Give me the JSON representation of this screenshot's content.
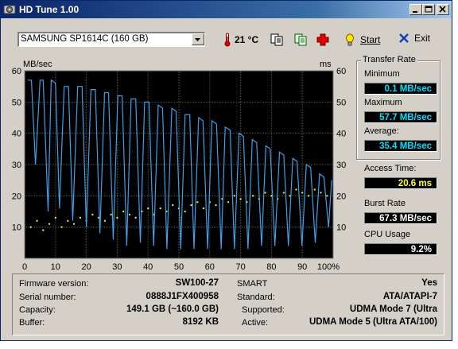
{
  "window": {
    "title": "HD Tune 1.00"
  },
  "toolbar": {
    "drive": "SAMSUNG SP1614C (160 GB)",
    "temperature": "21 °C",
    "start_label": "Start",
    "exit_label": "Exit"
  },
  "graph": {
    "left_unit": "MB/sec",
    "right_unit": "ms",
    "y_ticks": [
      "60",
      "50",
      "40",
      "30",
      "20",
      "10"
    ],
    "x_ticks": [
      "0",
      "10",
      "20",
      "30",
      "40",
      "50",
      "60",
      "70",
      "80",
      "90",
      "100%"
    ]
  },
  "chart_data": {
    "type": "line",
    "xlabel": "",
    "ylabel": "MB/sec",
    "y2label": "ms",
    "xlim": [
      0,
      100
    ],
    "ylim": [
      0,
      60
    ],
    "y2lim": [
      0,
      60
    ],
    "grid": true,
    "series": [
      {
        "type": "line",
        "color": "#3fa0e8",
        "x": [
          1,
          2.2,
          3.5,
          5,
          6,
          7.6,
          8.6,
          10,
          11.3,
          12.8,
          14.2,
          15.6,
          17.2,
          18.6,
          20,
          21.5,
          22.9,
          24.4,
          25.9,
          27.2,
          28.7,
          30.2,
          31.6,
          33.1,
          34.5,
          36,
          37.5,
          38.9,
          40.3,
          41.8,
          43.3,
          44.7,
          46.1,
          47.7,
          49.1,
          50.6,
          52,
          53.5,
          54.9,
          56.4,
          57.8,
          59.3,
          60.7,
          62.2,
          63.7,
          65,
          66.6,
          68,
          69.5,
          70.9,
          72.4,
          73.8,
          75.2,
          76.8,
          78.2,
          79.6,
          81.1,
          82.6,
          84,
          85.5,
          86.9,
          88.3,
          89.9,
          91.3,
          92.7,
          94.2,
          95.6,
          97,
          98.5,
          99.5
        ],
        "y": [
          57,
          57,
          30,
          57,
          57,
          15,
          57,
          56,
          16,
          55,
          55,
          12,
          55,
          55,
          10,
          54,
          54,
          8,
          53,
          53,
          6,
          52,
          52,
          4,
          51,
          51,
          5,
          50,
          50,
          4,
          49,
          48,
          3,
          48,
          47,
          3,
          46,
          46,
          3,
          45,
          44,
          3,
          44,
          43,
          3,
          42,
          41,
          3,
          40,
          39,
          3,
          38,
          37,
          4,
          36,
          35,
          4,
          34,
          33,
          4,
          32,
          31,
          4,
          30,
          29,
          5,
          27,
          26,
          10,
          25
        ]
      },
      {
        "type": "scatter",
        "color": "#e0e040",
        "x": [
          2,
          4,
          6,
          8,
          10,
          12,
          14,
          16,
          18,
          20,
          22,
          24,
          26,
          28,
          30,
          32,
          34,
          36,
          38,
          40,
          42,
          44,
          46,
          48,
          50,
          52,
          54,
          56,
          58,
          60,
          62,
          64,
          66,
          68,
          70,
          72,
          74,
          76,
          78,
          80,
          82,
          84,
          86,
          88,
          90,
          92,
          94,
          96,
          98
        ],
        "y": [
          10,
          12,
          9,
          11,
          13,
          10,
          12,
          11,
          13,
          12,
          14,
          13,
          12,
          14,
          13,
          15,
          14,
          13,
          15,
          16,
          14,
          16,
          15,
          17,
          16,
          15,
          17,
          18,
          16,
          18,
          17,
          19,
          18,
          20,
          19,
          18,
          20,
          19,
          21,
          20,
          19,
          21,
          20,
          22,
          21,
          20,
          22,
          21,
          20
        ]
      }
    ]
  },
  "transfer_rate": {
    "title": "Transfer Rate",
    "min_label": "Minimum",
    "min_value": "0.1 MB/sec",
    "max_label": "Maximum",
    "max_value": "57.7 MB/sec",
    "avg_label": "Average:",
    "avg_value": "35.4 MB/sec"
  },
  "access_time": {
    "label": "Access Time:",
    "value": "20.6 ms"
  },
  "burst_rate": {
    "label": "Burst Rate",
    "value": "67.3 MB/sec"
  },
  "cpu_usage": {
    "label": "CPU Usage",
    "value": "9.2%"
  },
  "info": {
    "firmware_label": "Firmware version:",
    "firmware": "SW100-27",
    "serial_label": "Serial number:",
    "serial": "0888J1FX400958",
    "capacity_label": "Capacity:",
    "capacity": "149.1 GB (~160.0 GB)",
    "buffer_label": "Buffer:",
    "buffer": "8192 KB",
    "smart_label": "SMART",
    "smart": "Yes",
    "standard_label": "Standard:",
    "standard": "ATA/ATAPI-7",
    "supported_label": "Supported:",
    "supported": "UDMA Mode 7 (Ultra",
    "active_label": "Active:",
    "active": "UDMA Mode 5 (Ultra ATA/100)"
  }
}
